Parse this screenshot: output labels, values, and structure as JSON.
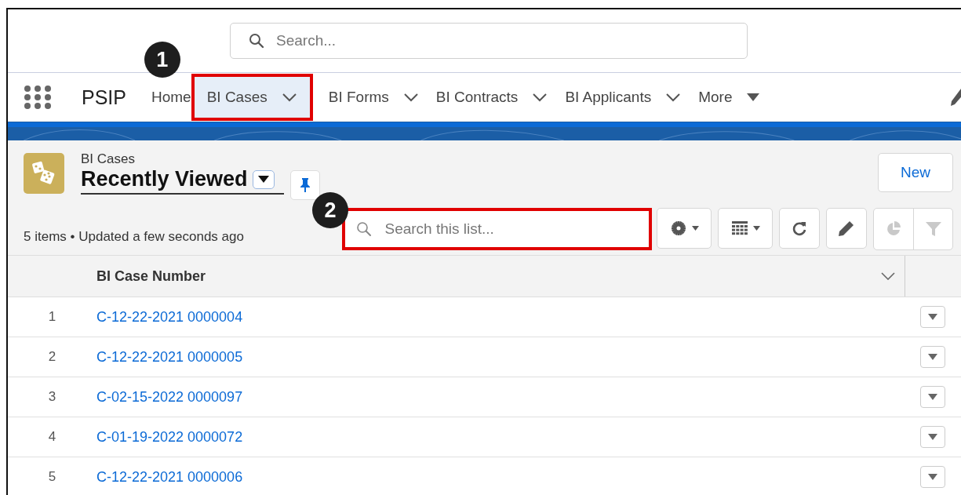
{
  "global_search": {
    "placeholder": "Search..."
  },
  "app_name": "PSIP",
  "nav_tabs": [
    {
      "label": "Home",
      "kind": "plain",
      "selected": false,
      "highlighted": false
    },
    {
      "label": "BI Cases",
      "kind": "dropdown",
      "selected": true,
      "highlighted": true,
      "callout": "1"
    },
    {
      "label": "BI Forms",
      "kind": "dropdown",
      "selected": false,
      "highlighted": false
    },
    {
      "label": "BI Contracts",
      "kind": "dropdown",
      "selected": false,
      "highlighted": false
    },
    {
      "label": "BI Applicants",
      "kind": "dropdown",
      "selected": false,
      "highlighted": false
    },
    {
      "label": "More",
      "kind": "more",
      "selected": false,
      "highlighted": false
    }
  ],
  "list_header": {
    "object_name": "BI Cases",
    "list_view": "Recently Viewed",
    "status": "5 items • Updated a few seconds ago",
    "new_button": "New"
  },
  "list_search": {
    "placeholder": "Search this list...",
    "highlighted": true,
    "callout": "2"
  },
  "toolbar": [
    {
      "kind": "settings",
      "disabled": false
    },
    {
      "kind": "display",
      "disabled": false
    },
    {
      "kind": "refresh",
      "disabled": false
    },
    {
      "kind": "edit",
      "disabled": false
    },
    {
      "kind": "chart",
      "disabled": true
    },
    {
      "kind": "filter",
      "disabled": true
    }
  ],
  "table": {
    "columns": [
      "BI Case Number"
    ],
    "rows": [
      {
        "index": "1",
        "case_number": "C-12-22-2021 0000004"
      },
      {
        "index": "2",
        "case_number": "C-12-22-2021 0000005"
      },
      {
        "index": "3",
        "case_number": "C-02-15-2022 0000097"
      },
      {
        "index": "4",
        "case_number": "C-01-19-2022 0000072"
      },
      {
        "index": "5",
        "case_number": "C-12-22-2021 0000006"
      }
    ]
  }
}
